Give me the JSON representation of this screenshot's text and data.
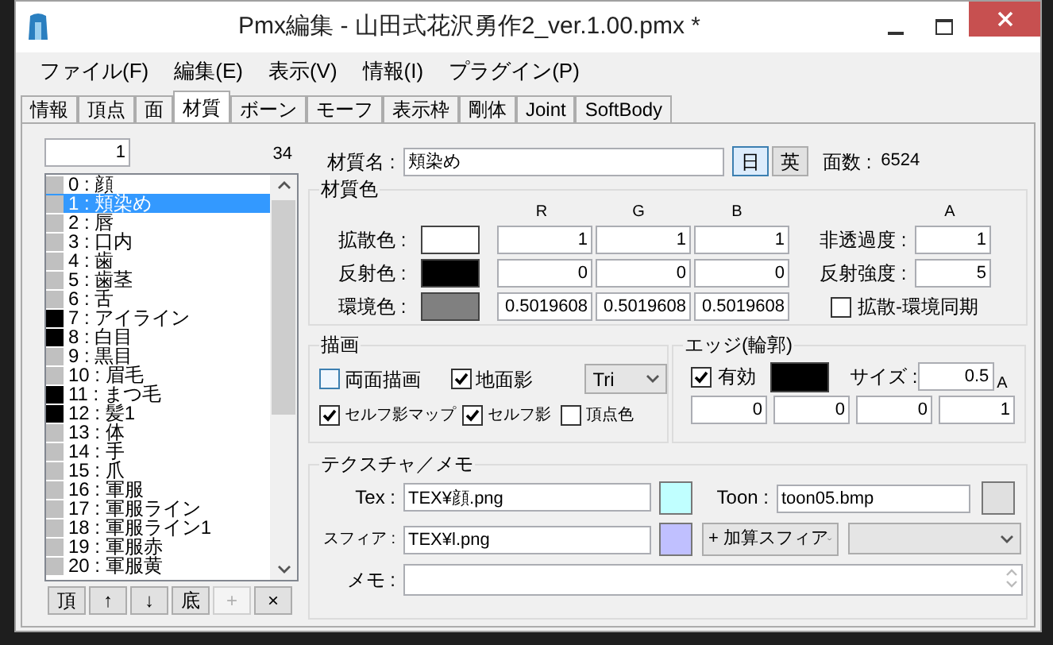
{
  "window": {
    "title": "Pmx編集 - 山田式花沢勇作2_ver.1.00.pmx *"
  },
  "menu": [
    "ファイル(F)",
    "編集(E)",
    "表示(V)",
    "情報(I)",
    "プラグイン(P)"
  ],
  "tabs": [
    {
      "label": "情報",
      "selected": false
    },
    {
      "label": "頂点",
      "selected": false
    },
    {
      "label": "面",
      "selected": false
    },
    {
      "label": "材質",
      "selected": true
    },
    {
      "label": "ボーン",
      "selected": false
    },
    {
      "label": "モーフ",
      "selected": false
    },
    {
      "label": "表示枠",
      "selected": false
    },
    {
      "label": "剛体",
      "selected": false
    },
    {
      "label": "Joint",
      "selected": false
    },
    {
      "label": "SoftBody",
      "selected": false
    }
  ],
  "material_list": {
    "index_value": "1",
    "count": "34",
    "items": [
      {
        "label": "0 : 顔",
        "color": "#c0c0c0",
        "selected": false
      },
      {
        "label": "1 : 頬染め",
        "color": "#c0c0c0",
        "selected": true
      },
      {
        "label": "2 : 唇",
        "color": "#c0c0c0",
        "selected": false
      },
      {
        "label": "3 : 口内",
        "color": "#c0c0c0",
        "selected": false
      },
      {
        "label": "4 : 歯",
        "color": "#c0c0c0",
        "selected": false
      },
      {
        "label": "5 : 歯茎",
        "color": "#c0c0c0",
        "selected": false
      },
      {
        "label": "6 : 舌",
        "color": "#c0c0c0",
        "selected": false
      },
      {
        "label": "7 : アイライン",
        "color": "#000000",
        "selected": false
      },
      {
        "label": "8 : 白目",
        "color": "#000000",
        "selected": false
      },
      {
        "label": "9 : 黒目",
        "color": "#c0c0c0",
        "selected": false
      },
      {
        "label": "10 : 眉毛",
        "color": "#c0c0c0",
        "selected": false
      },
      {
        "label": "11 : まつ毛",
        "color": "#000000",
        "selected": false
      },
      {
        "label": "12 : 髪1",
        "color": "#000000",
        "selected": false
      },
      {
        "label": "13 : 体",
        "color": "#c0c0c0",
        "selected": false
      },
      {
        "label": "14 : 手",
        "color": "#c0c0c0",
        "selected": false
      },
      {
        "label": "15 : 爪",
        "color": "#c0c0c0",
        "selected": false
      },
      {
        "label": "16 : 軍服",
        "color": "#c0c0c0",
        "selected": false
      },
      {
        "label": "17 : 軍服ライン",
        "color": "#c0c0c0",
        "selected": false
      },
      {
        "label": "18 : 軍服ライン1",
        "color": "#c0c0c0",
        "selected": false
      },
      {
        "label": "19 : 軍服赤",
        "color": "#c0c0c0",
        "selected": false
      },
      {
        "label": "20 : 軍服黄",
        "color": "#c0c0c0",
        "selected": false
      }
    ],
    "buttons": [
      {
        "label": "頂",
        "disabled": false
      },
      {
        "label": "↑",
        "disabled": false
      },
      {
        "label": "↓",
        "disabled": false
      },
      {
        "label": "底",
        "disabled": false
      },
      {
        "label": "+",
        "disabled": true
      },
      {
        "label": "×",
        "disabled": false
      }
    ]
  },
  "material_name": {
    "label": "材質名 :",
    "value": "頬染め",
    "lang_buttons": [
      {
        "label": "日",
        "selected": true
      },
      {
        "label": "英",
        "selected": false
      }
    ],
    "face_count_label": "面数 :",
    "face_count": "6524"
  },
  "material_color": {
    "title": "材質色",
    "headers": [
      "R",
      "G",
      "B"
    ],
    "alpha_header": "A",
    "rows": [
      {
        "label": "拡散色 :",
        "color": "#ffffff",
        "values": [
          "1",
          "1",
          "1"
        ]
      },
      {
        "label": "反射色 :",
        "color": "#000000",
        "values": [
          "0",
          "0",
          "0"
        ]
      },
      {
        "label": "環境色 :",
        "color": "#808080",
        "values": [
          "0.5019608",
          "0.5019608",
          "0.5019608"
        ]
      }
    ],
    "alpha_rows": [
      {
        "label": "非透過度 :",
        "value": "1"
      },
      {
        "label": "反射強度 :",
        "value": "5"
      }
    ],
    "sync": {
      "label": "拡散-環境同期",
      "checked": false
    }
  },
  "drawing": {
    "title": "描画",
    "options": [
      {
        "label": "両面描画",
        "checked": false
      },
      {
        "label": "地面影",
        "checked": true
      },
      {
        "label": "セルフ影マップ",
        "checked": true
      },
      {
        "label": "セルフ影",
        "checked": true
      },
      {
        "label": "頂点色",
        "checked": false
      }
    ],
    "select": "Tri"
  },
  "edge": {
    "title": "エッジ(輪郭)",
    "enabled": {
      "label": "有効",
      "checked": true
    },
    "color": "#000000",
    "size_label": "サイズ :",
    "size": "0.5",
    "alpha_header": "A",
    "values": [
      "0",
      "0",
      "0",
      "1"
    ]
  },
  "texture": {
    "title": "テクスチャ／メモ",
    "slots": [
      {
        "label": "Tex :",
        "value": "TEX¥顔.png",
        "color": "#c0ffff"
      },
      {
        "label": "Toon :",
        "value": "toon05.bmp",
        "color": "#e0e0e0"
      },
      {
        "label": "スフィア :",
        "value": "TEX¥l.png",
        "color": "#c0c0ff"
      }
    ],
    "sphere_mode": "+ 加算スフィア",
    "memo_label": "メモ :"
  }
}
